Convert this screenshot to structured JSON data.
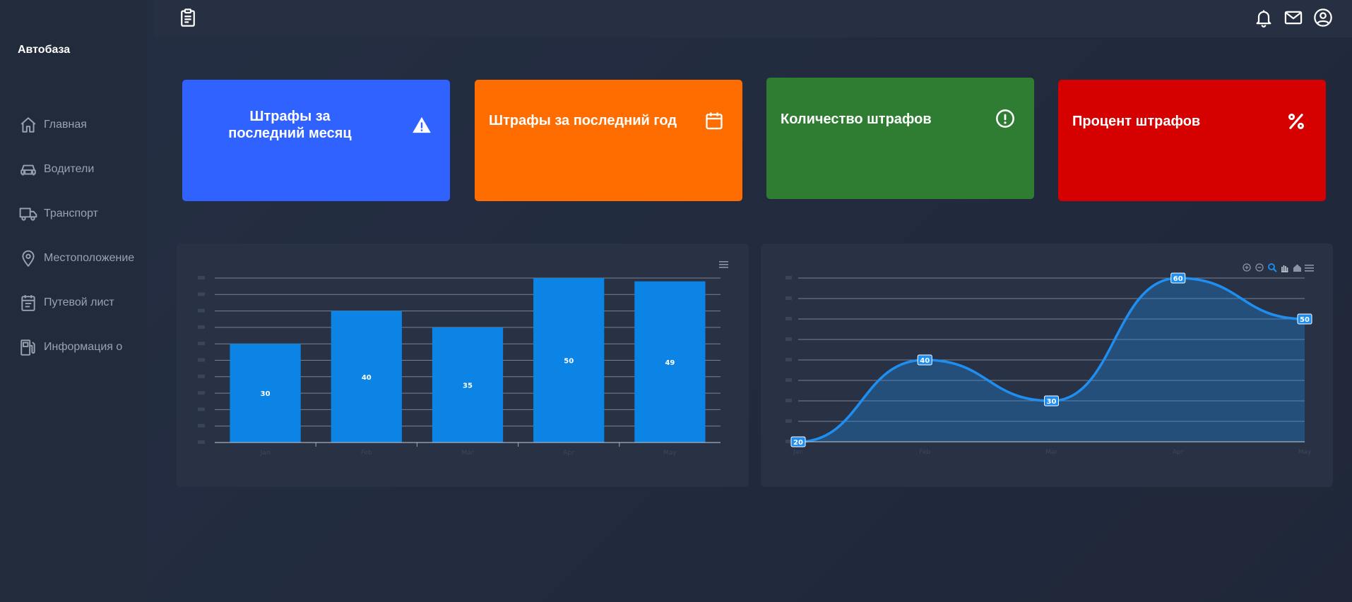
{
  "app": {
    "brand": "Автобаза"
  },
  "sidebar": {
    "items": [
      {
        "label": "Главная",
        "icon": "home-icon"
      },
      {
        "label": "Водители",
        "icon": "car-icon"
      },
      {
        "label": "Транспорт",
        "icon": "truck-icon"
      },
      {
        "label": "Местоположение",
        "icon": "location-pin-icon"
      },
      {
        "label": "Путевой лист",
        "icon": "waybill-icon"
      },
      {
        "label": "Информация о",
        "icon": "fuel-station-icon"
      }
    ]
  },
  "header": {
    "icons": [
      "clipboard-icon",
      "bell-icon",
      "mail-icon",
      "user-circle-icon"
    ]
  },
  "cards": [
    {
      "title": "Штрафы за последний месяц",
      "icon": "warning-icon",
      "color": "#2f62fe"
    },
    {
      "title": "Штрафы за последний год",
      "icon": "calendar-icon",
      "color": "#ff6c00"
    },
    {
      "title": "Количество штрафов",
      "icon": "alert-circle-icon",
      "color": "#2e7d32"
    },
    {
      "title": "Процент штрафов",
      "icon": "percent-icon",
      "color": "#d50000"
    }
  ],
  "chart_data": [
    {
      "type": "bar",
      "categories": [
        "Jan",
        "Feb",
        "Mar",
        "Apr",
        "May"
      ],
      "series": [
        {
          "values": [
            30,
            40,
            35,
            50,
            49
          ]
        }
      ],
      "ylim": [
        0,
        50
      ],
      "grid": true,
      "color": "#0b84e6",
      "toolbar": [
        "menu-icon"
      ]
    },
    {
      "type": "area",
      "categories": [
        "Jan",
        "Feb",
        "Mar",
        "Apr",
        "May"
      ],
      "series": [
        {
          "values": [
            20,
            40,
            30,
            60,
            50
          ]
        }
      ],
      "ylim": [
        20,
        60
      ],
      "grid": true,
      "color": "#1f8ef1",
      "toolbar": [
        "zoom-in-icon",
        "zoom-out-icon",
        "zoom-select-icon",
        "pan-icon",
        "reset-home-icon",
        "menu-icon"
      ]
    }
  ]
}
